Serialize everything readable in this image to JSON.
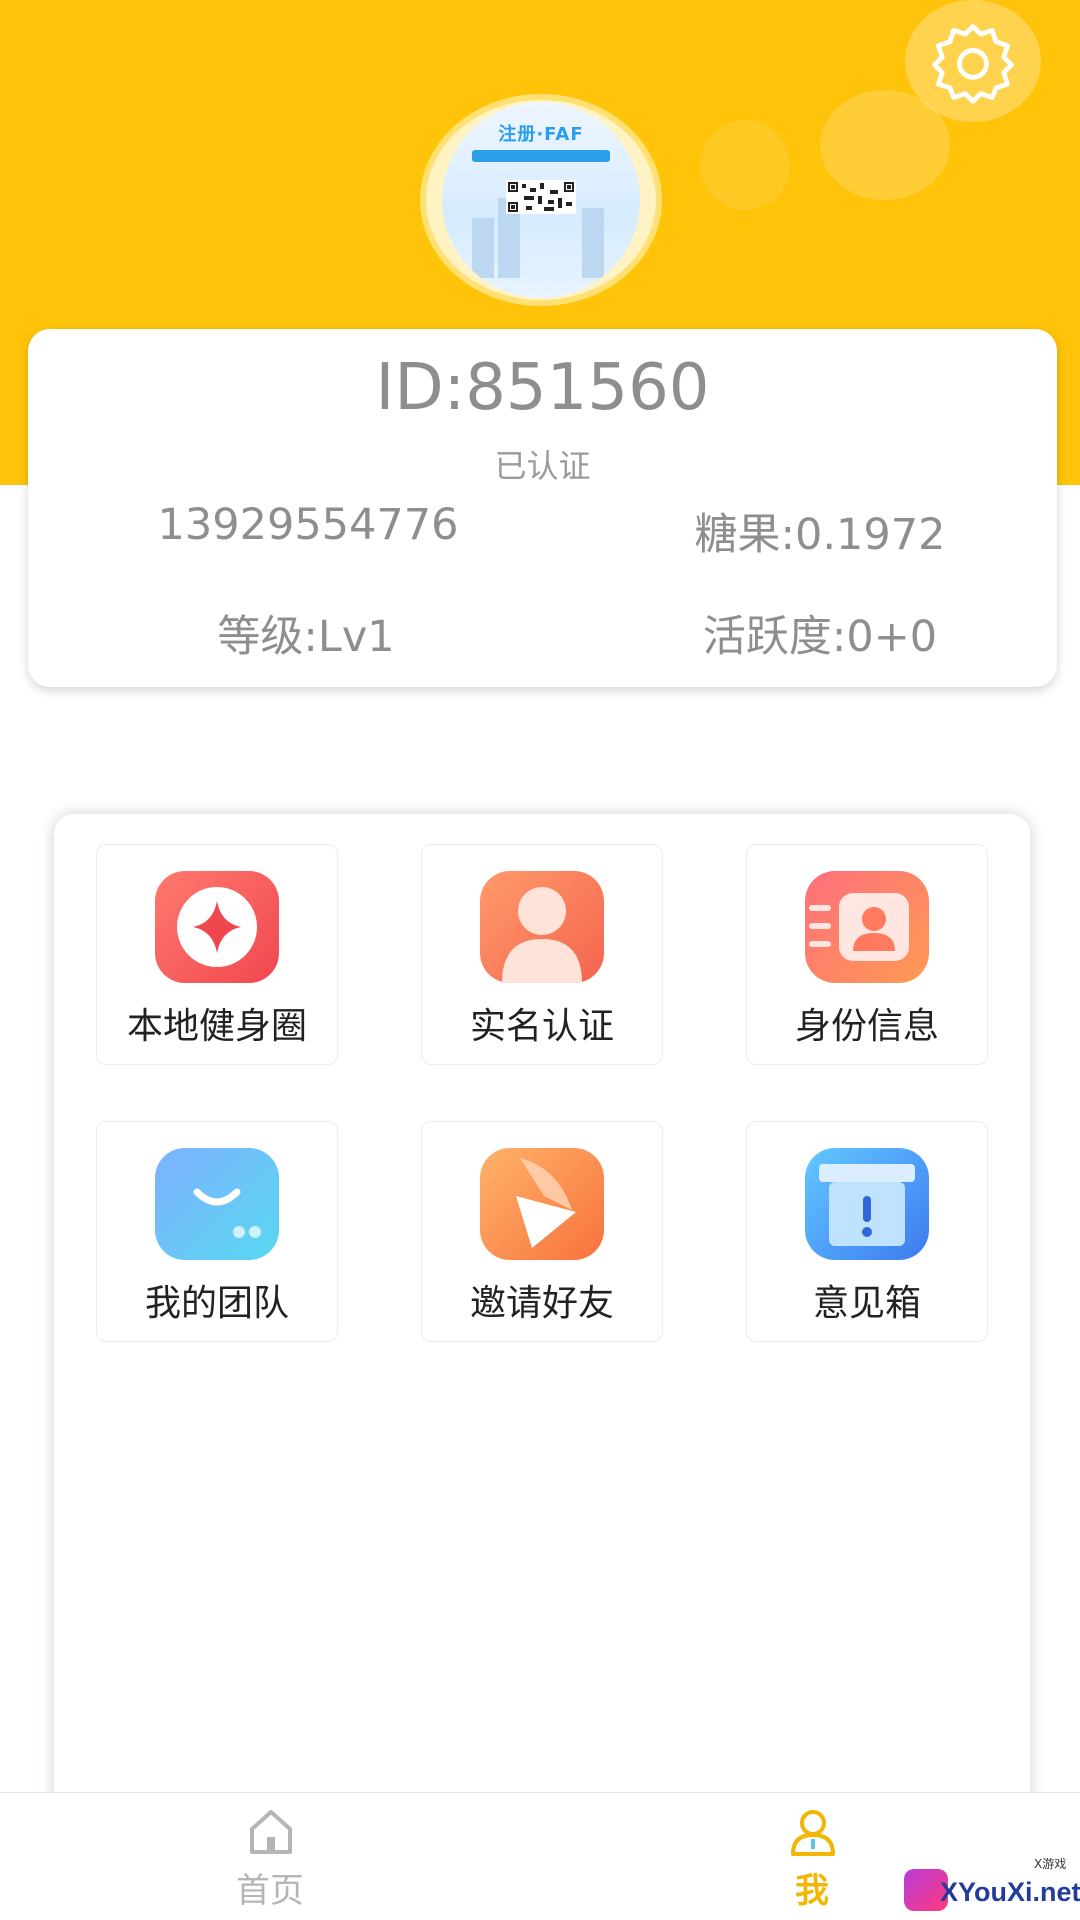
{
  "profile": {
    "avatar_title": "注册·FAF",
    "user_id": "ID:851560",
    "verify_status": "已认证",
    "phone": "13929554776",
    "candy": "糖果:0.1972",
    "level": "等级:Lv1",
    "activity": "活跃度:0+0"
  },
  "menu": [
    {
      "label": "本地健身圈",
      "icon": "diamond-badge-icon"
    },
    {
      "label": "实名认证",
      "icon": "person-id-icon"
    },
    {
      "label": "身份信息",
      "icon": "id-card-icon"
    },
    {
      "label": "我的团队",
      "icon": "chat-team-icon"
    },
    {
      "label": "邀请好友",
      "icon": "paper-plane-icon"
    },
    {
      "label": "意见箱",
      "icon": "feedback-box-icon"
    }
  ],
  "tabbar": {
    "home": "首页",
    "me": "我",
    "active": "me",
    "inactive_color": "#b5b5b5",
    "active_color": "#f2b705"
  },
  "watermark": {
    "small": "X游戏",
    "text": "XYouXi.net"
  },
  "colors": {
    "header": "#ffc30a",
    "text_gray": "#8e8e8e"
  }
}
